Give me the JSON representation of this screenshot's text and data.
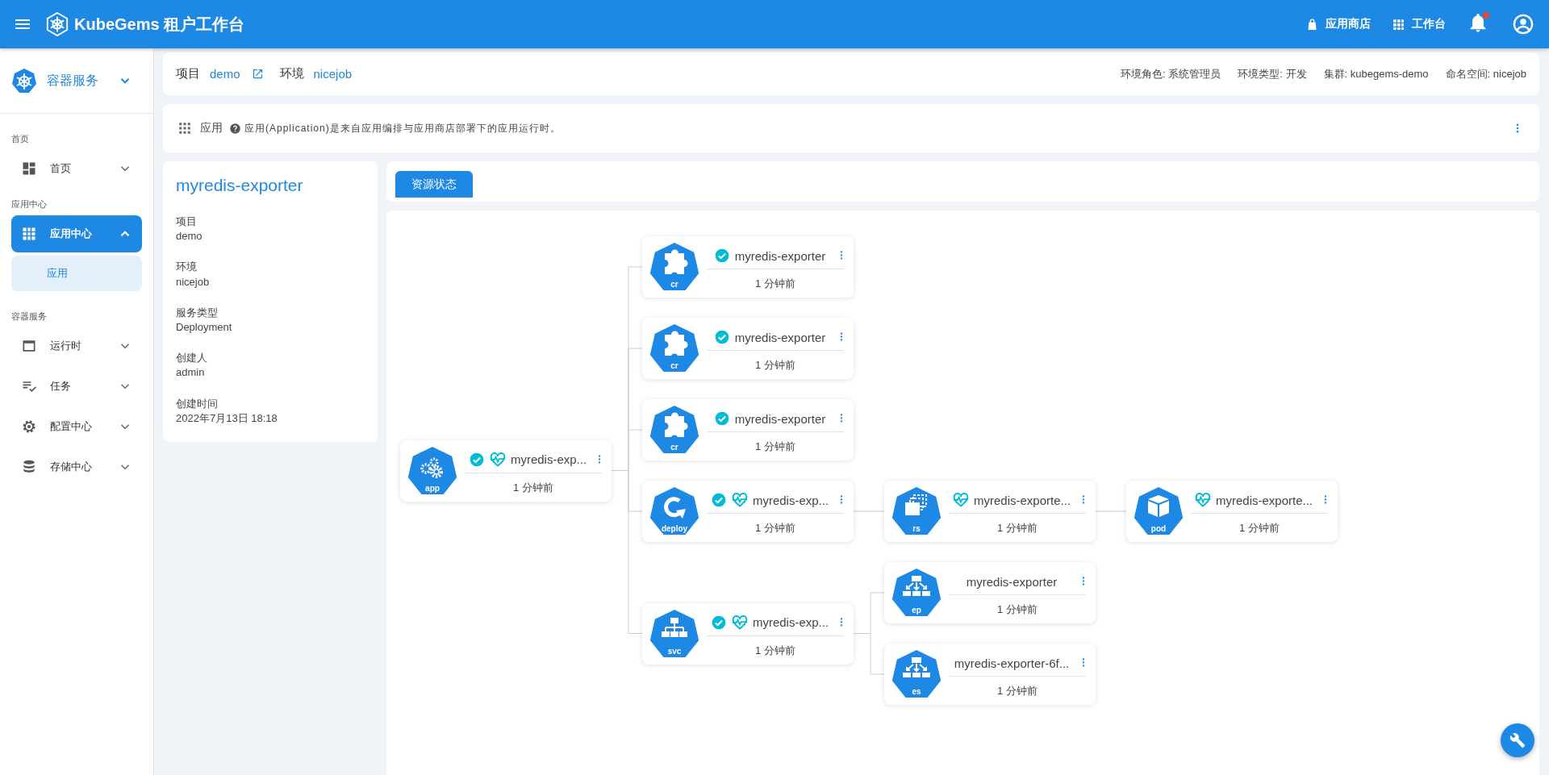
{
  "topbar": {
    "title": "KubeGems 租户工作台",
    "actions": [
      {
        "label": "应用商店",
        "kind": "bag"
      },
      {
        "label": "工作台",
        "kind": "grid"
      }
    ],
    "unread": true
  },
  "sidebar": {
    "switcher": "容器服务",
    "sections": [
      {
        "heading": "首页",
        "items": [
          {
            "label": "首页",
            "kind": "dashboard",
            "selected": false,
            "expanded": false
          }
        ]
      },
      {
        "heading": "应用中心",
        "items": [
          {
            "label": "应用中心",
            "kind": "apps",
            "selected": true,
            "expanded": true,
            "children": [
              {
                "label": "应用",
                "selected": true
              }
            ]
          }
        ]
      },
      {
        "heading": "容器服务",
        "items": [
          {
            "label": "运行时",
            "kind": "window",
            "selected": false,
            "expanded": false
          },
          {
            "label": "任务",
            "kind": "tasks",
            "selected": false,
            "expanded": false
          },
          {
            "label": "配置中心",
            "kind": "gear",
            "selected": false,
            "expanded": false
          },
          {
            "label": "存储中心",
            "kind": "database",
            "selected": false,
            "expanded": false
          }
        ]
      }
    ]
  },
  "context": {
    "project_label": "项目",
    "project": "demo",
    "env_label": "环境",
    "env": "nicejob",
    "meta": [
      "环境角色: 系统管理员",
      "环境类型: 开发",
      "集群: kubegems-demo",
      "命名空间: nicejob"
    ]
  },
  "app_bar": {
    "title": "应用",
    "description": "应用(Application)是来自应用编排与应用商店部署下的应用运行时。"
  },
  "details": {
    "title": "myredis-exporter",
    "fields": [
      {
        "label": "项目",
        "value": "demo"
      },
      {
        "label": "环境",
        "value": "nicejob"
      },
      {
        "label": "服务类型",
        "value": "Deployment"
      },
      {
        "label": "创建人",
        "value": "admin"
      },
      {
        "label": "创建时间",
        "value": "2022年7月13日 18:18"
      }
    ]
  },
  "tabs": [
    {
      "label": "资源状态",
      "selected": true
    }
  ],
  "tree": {
    "root": {
      "kind": "app",
      "label": "app",
      "name": "myredis-exp...",
      "ready": true,
      "healthy": true,
      "age": "1 分钟前",
      "children": [
        {
          "kind": "cr",
          "label": "cr",
          "name": "myredis-exporter",
          "ready": true,
          "healthy": false,
          "age": "1 分钟前"
        },
        {
          "kind": "cr",
          "label": "cr",
          "name": "myredis-exporter",
          "ready": true,
          "healthy": false,
          "age": "1 分钟前"
        },
        {
          "kind": "cr",
          "label": "cr",
          "name": "myredis-exporter",
          "ready": true,
          "healthy": false,
          "age": "1 分钟前"
        },
        {
          "kind": "deploy",
          "label": "deploy",
          "name": "myredis-exp...",
          "ready": true,
          "healthy": true,
          "age": "1 分钟前",
          "children": [
            {
              "kind": "rs",
              "label": "rs",
              "name": "myredis-exporte...",
              "ready": false,
              "healthy": true,
              "age": "1 分钟前",
              "children": [
                {
                  "kind": "pod",
                  "label": "pod",
                  "name": "myredis-exporte...",
                  "ready": false,
                  "healthy": true,
                  "age": "1 分钟前"
                }
              ]
            }
          ]
        },
        {
          "kind": "svc",
          "label": "svc",
          "name": "myredis-exp...",
          "ready": true,
          "healthy": true,
          "age": "1 分钟前",
          "children": [
            {
              "kind": "ep",
              "label": "ep",
              "name": "myredis-exporter",
              "ready": false,
              "healthy": false,
              "age": "1 分钟前"
            },
            {
              "kind": "es",
              "label": "es",
              "name": "myredis-exporter-6f...",
              "ready": false,
              "healthy": false,
              "age": "1 分钟前"
            }
          ]
        }
      ]
    }
  }
}
